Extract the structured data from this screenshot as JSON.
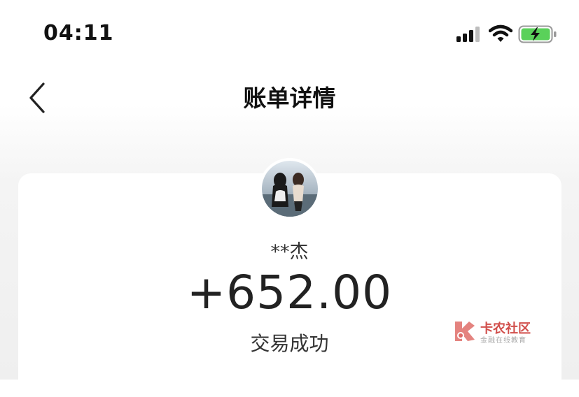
{
  "status_bar": {
    "time": "04:11",
    "battery_state": "charging"
  },
  "nav": {
    "title": "账单详情",
    "back_icon": "chevron-left-icon"
  },
  "transaction": {
    "counterparty": "**杰",
    "amount": "+652.00",
    "status": "交易成功"
  },
  "watermark": {
    "title": "卡农社区",
    "subtitle": "金融在线教育"
  },
  "colors": {
    "battery_fill": "#5ad15a",
    "watermark_red": "#c9302c"
  }
}
